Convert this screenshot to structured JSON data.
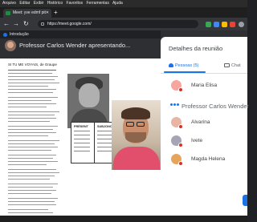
{
  "menubar": {
    "items": [
      "Arquivo",
      "Editar",
      "Exibir",
      "Histórico",
      "Favoritos",
      "Ferramentas",
      "Ajuda"
    ]
  },
  "browser": {
    "tab_title": "Meet: yve edmf pit",
    "url": "https://meet.google.com/",
    "new_tab_label": "+"
  },
  "meet": {
    "top_label": "Introdução",
    "presenter_label": "Professor Carlos Wender apresentando..."
  },
  "document": {
    "title": "SI TU ME VOYAIS, de Graupe",
    "box_left_title": "PRÉSENT",
    "box_right_title": "SUBJONCTIF"
  },
  "panel": {
    "title": "Detalhes da reunião",
    "tab_people": "Pessoas (5)",
    "tab_chat": "Chat",
    "participants": [
      {
        "name": "Maria Elisa",
        "avatar_color": "#f8a5a0"
      },
      {
        "name": "Professor Carlos Wender",
        "avatar_color": "#8a7a6b"
      },
      {
        "name": "Alvarina",
        "avatar_color": "#e8b4a4"
      },
      {
        "name": "Ivete",
        "avatar_color": "#a5a5b5"
      },
      {
        "name": "Magda Helena",
        "avatar_color": "#e7a45d"
      }
    ]
  },
  "colors": {
    "accent": "#1a73e8",
    "mic_off": "#d93025"
  }
}
